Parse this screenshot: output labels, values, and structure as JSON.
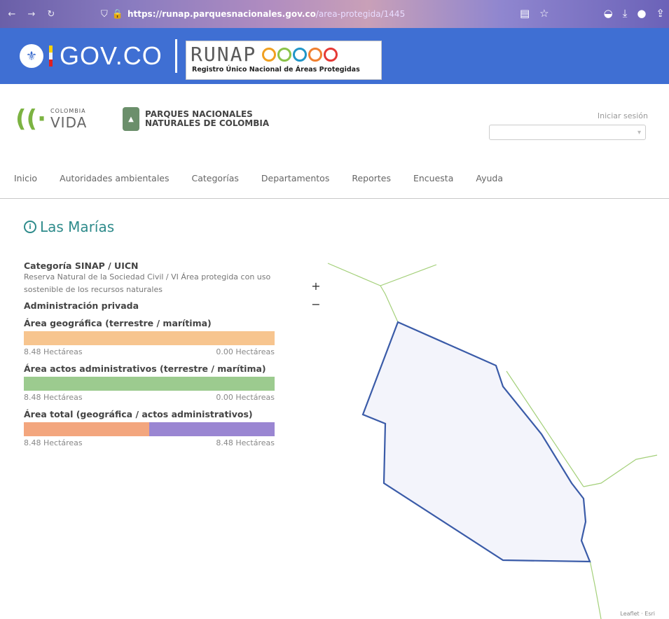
{
  "browser": {
    "url_domain": "https://runap.parquesnacionales.gov.co",
    "url_path": "/area-protegida/1445"
  },
  "gov": {
    "name": "GOV.CO"
  },
  "runap": {
    "name": "RUNAP",
    "subtitle": "Registro Único Nacional de Áreas Protegidas"
  },
  "logos": {
    "colombia_small": "COLOMBIA",
    "vida": "VIDA",
    "pnn_line1": "PARQUES NACIONALES",
    "pnn_line2": "NATURALES DE COLOMBIA"
  },
  "header": {
    "login": "Iniciar sesión"
  },
  "nav": {
    "items": [
      "Inicio",
      "Autoridades ambientales",
      "Categorías",
      "Departamentos",
      "Reportes",
      "Encuesta",
      "Ayuda"
    ]
  },
  "area": {
    "title": "Las Marías",
    "category_label": "Categoría SINAP / UICN",
    "category_value": "Reserva Natural de la Sociedad Civil / VI Área protegida con uso sostenible de los recursos naturales",
    "admin": "Administración privada",
    "geo_title": "Área geográfica (terrestre / marítima)",
    "geo_left": "8.48 Hectáreas",
    "geo_right": "0.00 Hectáreas",
    "acts_title": "Área actos administrativos (terrestre / marítima)",
    "acts_left": "8.48 Hectáreas",
    "acts_right": "0.00 Hectáreas",
    "total_title": "Área total (geográfica / actos administrativos)",
    "total_left": "8.48 Hectáreas",
    "total_right": "8.48 Hectáreas"
  },
  "map": {
    "zoom_in": "+",
    "zoom_out": "−",
    "attribution": "Leaflet · Esri"
  },
  "colors": {
    "gov_blue": "#3f6fd3",
    "title_teal": "#2e8b8b",
    "polygon": "#3a5ba8",
    "road": "#a4d07a"
  }
}
